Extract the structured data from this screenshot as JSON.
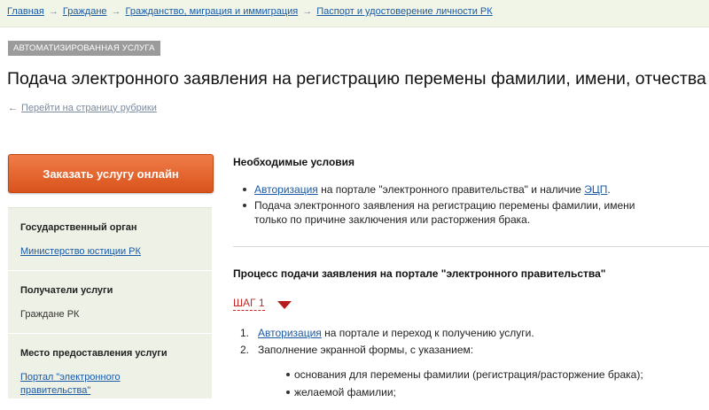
{
  "breadcrumb": {
    "items": [
      "Главная",
      "Граждане",
      "Гражданство, миграция и иммиграция",
      "Паспорт и удостоверение личности РК"
    ],
    "separator": "→"
  },
  "service_tag": "АВТОМАТИЗИРОВАННАЯ УСЛУГА",
  "page_title": "Подача электронного заявления на регистрацию перемены фамилии, имени, отчества",
  "back_link": {
    "arrow": "←",
    "label": "Перейти на страницу рубрики"
  },
  "order_button": {
    "label": "Заказать услугу онлайн",
    "color": "#e7652b"
  },
  "sidebar": {
    "blocks": [
      {
        "heading": "Государственный орган",
        "value": "Министерство юстиции РК",
        "is_link": true
      },
      {
        "heading": "Получатели услуги",
        "value": "Граждане РК",
        "is_link": false
      },
      {
        "heading": "Место предоставления услуги",
        "value": "Портал \"электронного правительства\"",
        "is_link": true
      }
    ]
  },
  "conditions": {
    "title": "Необходимые условия",
    "items": [
      {
        "link": "Авторизация",
        "text_mid": " на портале \"электронного правительства\" и наличие ",
        "link2": "ЭЦП",
        "text_end": "."
      },
      {
        "line1": "Подача электронного заявления на регистрацию перемены фамилии, имени",
        "line2": "только по причине заключения или расторжения брака."
      }
    ]
  },
  "process": {
    "title": "Процесс подачи заявления на портале \"электронного правительства\"",
    "step_label": "ШАГ 1",
    "steps": [
      {
        "num": "1.",
        "link": "Авторизация",
        "text": " на портале и переход к получению услуги."
      },
      {
        "num": "2.",
        "text": "Заполнение экранной формы, с указанием:"
      }
    ],
    "sub_items": [
      "основания для перемены фамилии (регистрация/расторжение брака);",
      "желаемой фамилии;"
    ]
  },
  "colors": {
    "accent_red": "#c62828",
    "link_blue": "#1a5aa6",
    "sidebar_bg": "#eef1e6"
  }
}
